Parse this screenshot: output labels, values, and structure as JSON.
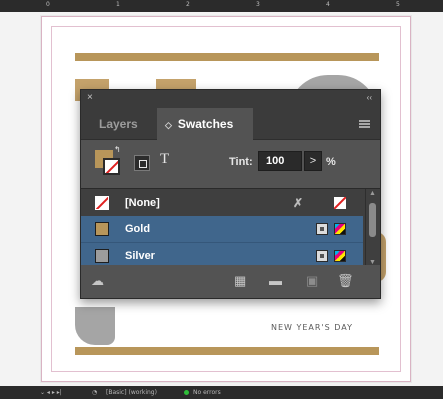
{
  "ruler": {
    "labels": [
      "0",
      "1",
      "2",
      "3",
      "4",
      "5"
    ]
  },
  "page": {
    "caption": "NEW YEAR'S DAY",
    "colors": {
      "gold": "#b8965a",
      "gray": "#a5a5a5"
    }
  },
  "panel": {
    "close_glyph": "×",
    "collapse_glyph": "‹‹",
    "tabs": [
      {
        "label": "Layers",
        "active": false
      },
      {
        "label": "Swatches",
        "active": true
      }
    ],
    "text_mode_glyph": "T",
    "tint_label": "Tint:",
    "tint_value": "100",
    "tint_arrow": ">",
    "tint_unit": "%",
    "swatches": [
      {
        "name": "[None]",
        "color": "none",
        "selected": false
      },
      {
        "name": "Gold",
        "color": "#b8965a",
        "selected": true
      },
      {
        "name": "Silver",
        "color": "#9c9c9c",
        "selected": true
      }
    ],
    "selection_color": "#40668c",
    "footer_icons": [
      "cloud-libraries-icon",
      "swatch-views-icon",
      "new-color-group-icon",
      "new-swatch-icon",
      "delete-swatch-icon"
    ]
  },
  "status": {
    "profile": "[Basic] (working)",
    "preflight": "No errors"
  }
}
